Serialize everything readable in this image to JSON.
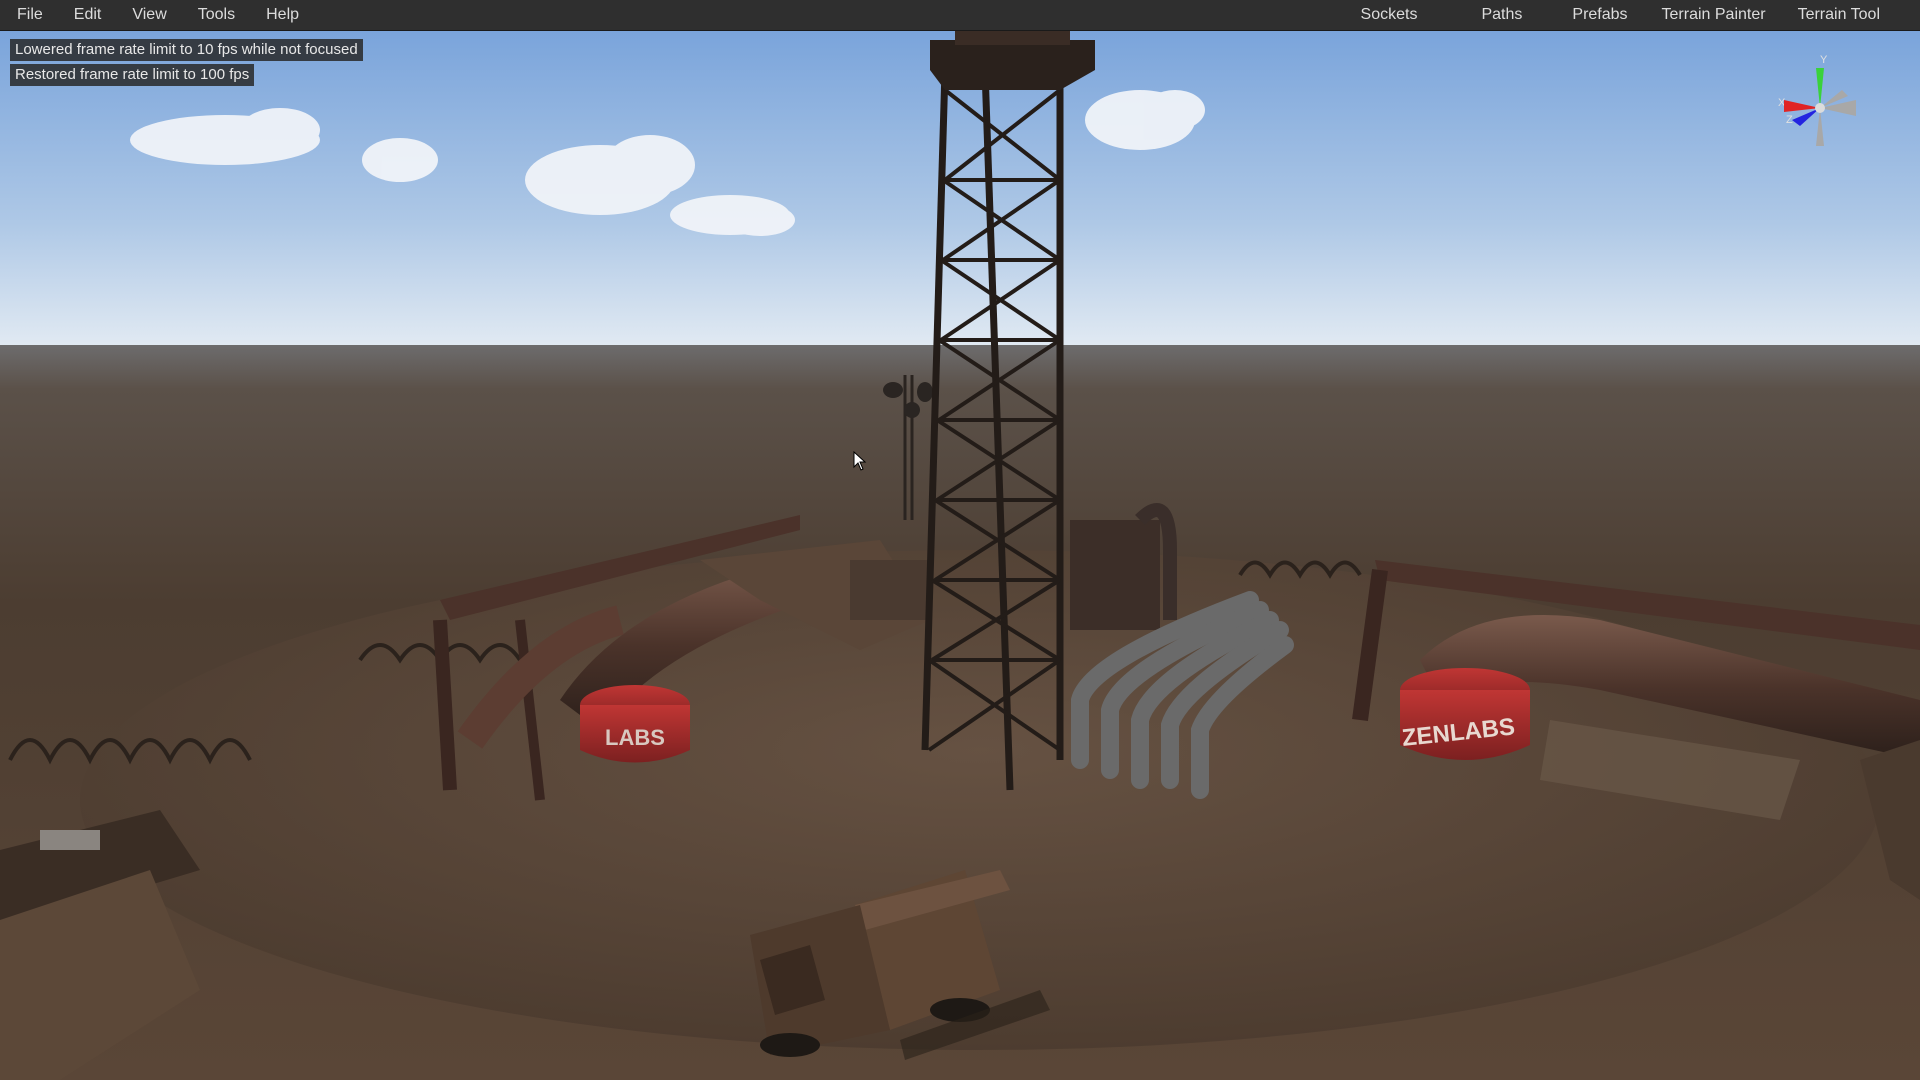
{
  "menubar": {
    "left": [
      {
        "label": "File"
      },
      {
        "label": "Edit"
      },
      {
        "label": "View"
      },
      {
        "label": "Tools"
      },
      {
        "label": "Help"
      }
    ],
    "right": [
      {
        "label": "Sockets"
      },
      {
        "label": "Paths"
      },
      {
        "label": "Prefabs"
      },
      {
        "label": "Terrain Painter"
      },
      {
        "label": "Terrain Tool"
      }
    ]
  },
  "console": {
    "messages": [
      "Lowered frame rate limit to 10 fps while not focused",
      "Restored frame rate limit to 100 fps"
    ]
  },
  "viewport": {
    "tank_label_right": "ZENLABS",
    "tank_label_left": "LABS",
    "colors": {
      "sky_top": "#7fa8dc",
      "sky_horizon": "#dfe8f2",
      "ground": "#5a4a3c",
      "rust": "#5b3b30",
      "tank_red": "#a02a28"
    }
  },
  "gizmo": {
    "y_label": "Y",
    "x_label": "X",
    "z_label": "Z"
  }
}
